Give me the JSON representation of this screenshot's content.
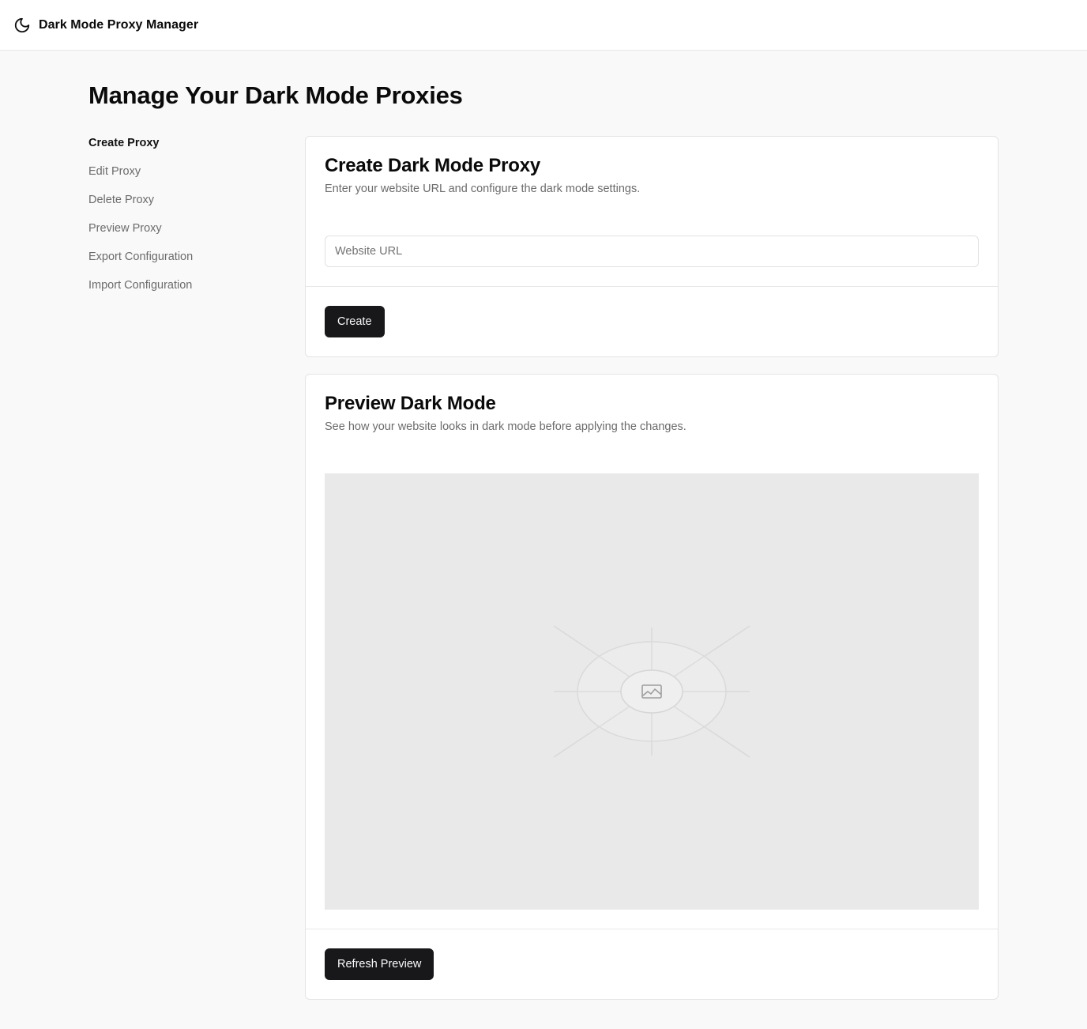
{
  "app": {
    "title": "Dark Mode Proxy Manager",
    "icon": "moon-icon"
  },
  "page": {
    "title": "Manage Your Dark Mode Proxies"
  },
  "sidebar": {
    "items": [
      {
        "label": "Create Proxy",
        "active": true
      },
      {
        "label": "Edit Proxy",
        "active": false
      },
      {
        "label": "Delete Proxy",
        "active": false
      },
      {
        "label": "Preview Proxy",
        "active": false
      },
      {
        "label": "Export Configuration",
        "active": false
      },
      {
        "label": "Import Configuration",
        "active": false
      }
    ]
  },
  "create_card": {
    "title": "Create Dark Mode Proxy",
    "description": "Enter your website URL and configure the dark mode settings.",
    "url_input": {
      "placeholder": "Website URL",
      "value": ""
    },
    "button_label": "Create"
  },
  "preview_card": {
    "title": "Preview Dark Mode",
    "description": "See how your website looks in dark mode before applying the changes.",
    "image_icon": "image-placeholder-icon",
    "button_label": "Refresh Preview"
  },
  "colors": {
    "background": "#f8f9f8",
    "surface": "#ffffff",
    "primary_button": "#18181b",
    "muted_text": "#6b6b6b",
    "preview_placeholder": "#e9e9e9"
  }
}
